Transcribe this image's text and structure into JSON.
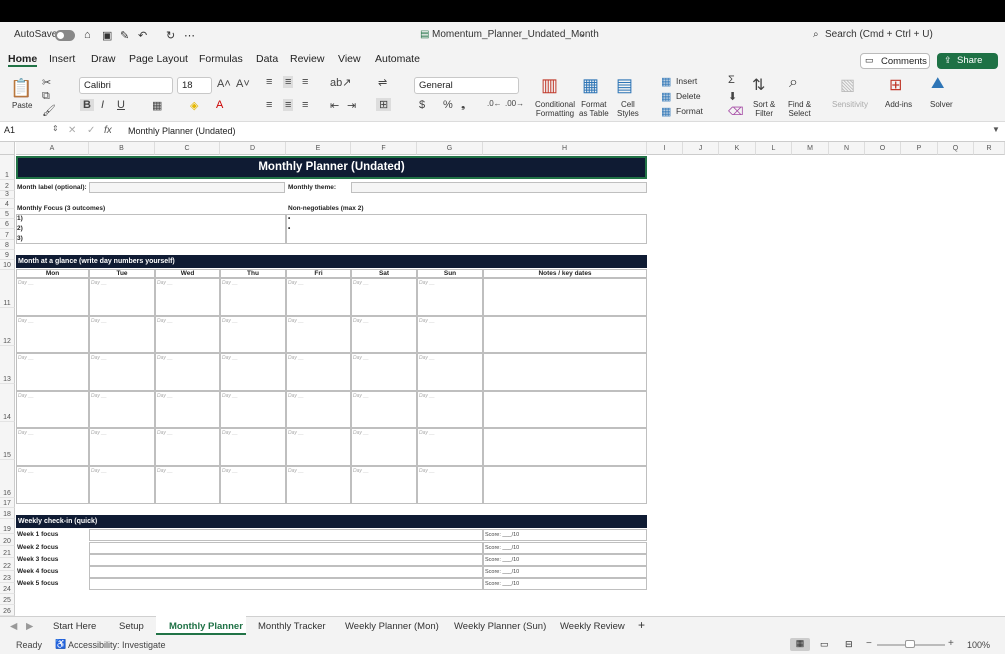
{
  "window": {
    "autosave": "AutoSave",
    "filename": "Momentum_Planner_Undated_Month",
    "search": "Search (Cmd + Ctrl + U)"
  },
  "menu": {
    "items": [
      "Home",
      "Insert",
      "Draw",
      "Page Layout",
      "Formulas",
      "Data",
      "Review",
      "View",
      "Automate"
    ],
    "comments": "Comments",
    "share": "Share"
  },
  "ribbon": {
    "paste": "Paste",
    "font_name": "Calibri",
    "font_size": "18",
    "number_format": "General",
    "conditional": "Conditional\nFormatting",
    "format_table": "Format\nas Table",
    "cell_styles": "Cell\nStyles",
    "insert": "Insert",
    "delete": "Delete",
    "format": "Format",
    "sort": "Sort &\nFilter",
    "find": "Find &\nSelect",
    "sensitivity": "Sensitivity",
    "addins": "Add-ins",
    "solver": "Solver"
  },
  "formula": {
    "cell_ref": "A1",
    "fx": "fx",
    "value": "Monthly Planner (Undated)"
  },
  "columns": [
    "A",
    "B",
    "C",
    "D",
    "E",
    "F",
    "G",
    "H",
    "I",
    "J",
    "K",
    "L",
    "M",
    "N",
    "O",
    "P",
    "Q",
    "R",
    "S"
  ],
  "rows": [
    "1",
    "2",
    "3",
    "4",
    "5",
    "6",
    "7",
    "8",
    "9",
    "10",
    "11",
    "12",
    "13",
    "14",
    "15",
    "16",
    "17",
    "18",
    "19",
    "20",
    "21",
    "22",
    "23",
    "24",
    "25",
    "26"
  ],
  "sheet": {
    "title": "Monthly Planner (Undated)",
    "month_label": "Month label (optional):",
    "monthly_theme": "Monthly theme:",
    "focus_header": "Monthly Focus (3 outcomes)",
    "focus_items": [
      "1)",
      "2)",
      "3)"
    ],
    "nonneg_header": "Non-negotiables (max 2)",
    "nonneg_items": [
      "•",
      "•"
    ],
    "glance_header": "Month at a glance (write day numbers yourself)",
    "days": [
      "Mon",
      "Tue",
      "Wed",
      "Thu",
      "Fri",
      "Sat",
      "Sun"
    ],
    "notes_header": "Notes / key dates",
    "day_placeholder": "Day __",
    "checkin_header": "Weekly check-in (quick)",
    "weeks": [
      "Week 1 focus",
      "Week 2 focus",
      "Week 3 focus",
      "Week 4 focus",
      "Week 5 focus"
    ],
    "score": "Score: ___/10"
  },
  "tabs": [
    "Start Here",
    "Setup",
    "Monthly Planner",
    "Monthly Tracker",
    "Weekly Planner (Mon)",
    "Weekly Planner (Sun)",
    "Weekly Review"
  ],
  "active_tab": "Monthly Planner",
  "status": {
    "ready": "Ready",
    "accessibility": "Accessibility: Investigate",
    "zoom": "100%"
  }
}
